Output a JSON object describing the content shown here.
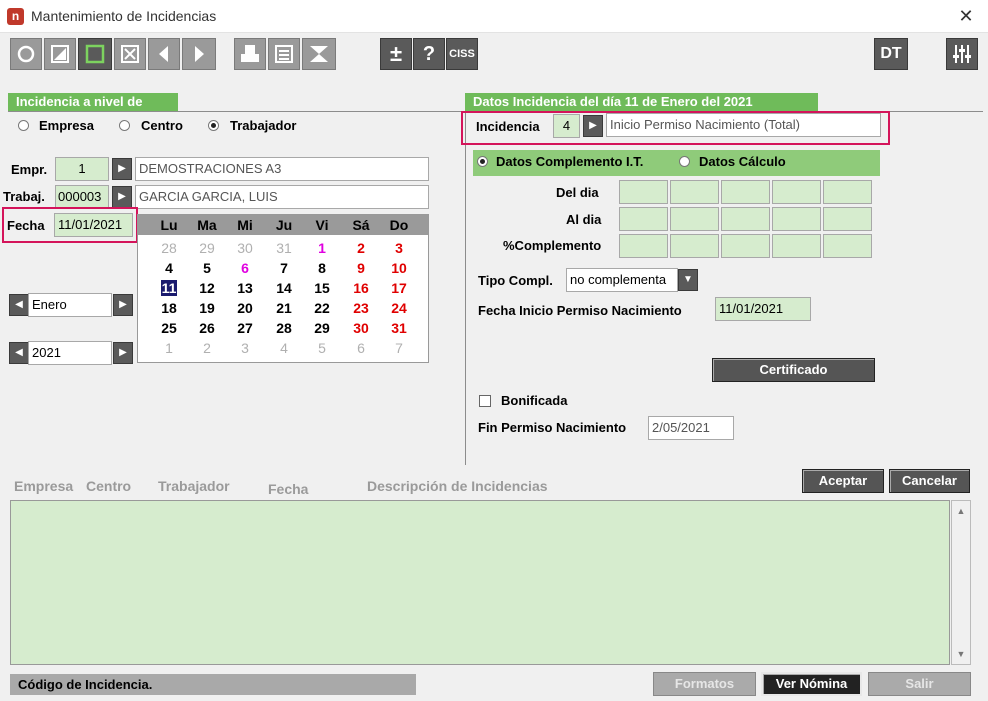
{
  "window": {
    "title": "Mantenimiento de Incidencias",
    "close_glyph": "✕",
    "app_icon_letter": "n"
  },
  "toolbar": {
    "plus_minus": "±",
    "help": "?",
    "ciss": "CISS",
    "dt": "DT"
  },
  "left": {
    "section_title": "Incidencia a nivel de",
    "radios": [
      {
        "label": "Empresa",
        "selected": false
      },
      {
        "label": "Centro",
        "selected": false
      },
      {
        "label": "Trabajador",
        "selected": true
      }
    ],
    "empr_label": "Empr.",
    "empr_code": "1",
    "empr_name": "DEMOSTRACIONES A3",
    "trabaj_label": "Trabaj.",
    "trabaj_code": "000003",
    "trabaj_name": "GARCIA GARCIA, LUIS",
    "fecha_label": "Fecha",
    "fecha_value": "11/01/2021",
    "month_value": "Enero",
    "year_value": "2021"
  },
  "calendar": {
    "headers": [
      "Lu",
      "Ma",
      "Mi",
      "Ju",
      "Vi",
      "Sá",
      "Do"
    ],
    "weeks": [
      [
        "28",
        "29",
        "30",
        "31",
        "1",
        "2",
        "3"
      ],
      [
        "4",
        "5",
        "6",
        "7",
        "8",
        "9",
        "10"
      ],
      [
        "11",
        "12",
        "13",
        "14",
        "15",
        "16",
        "17"
      ],
      [
        "18",
        "19",
        "20",
        "21",
        "22",
        "23",
        "24"
      ],
      [
        "25",
        "26",
        "27",
        "28",
        "29",
        "30",
        "31"
      ],
      [
        "1",
        "2",
        "3",
        "4",
        "5",
        "6",
        "7"
      ]
    ],
    "selected_day": "11"
  },
  "right": {
    "section_title": "Datos Incidencia del día 11 de Enero del 2021",
    "incidencia_label": "Incidencia",
    "incidencia_code": "4",
    "incidencia_desc": "Inicio Permiso Nacimiento (Total)",
    "tabs": [
      {
        "label": "Datos Complemento I.T.",
        "selected": true
      },
      {
        "label": "Datos Cálculo",
        "selected": false
      }
    ],
    "del_dia_label": "Del dia",
    "al_dia_label": "Al dia",
    "complemento_label": "%Complemento",
    "tipo_compl_label": "Tipo Compl.",
    "tipo_compl_value": "no complementa",
    "fecha_inicio_label": "Fecha Inicio Permiso Nacimiento",
    "fecha_inicio_value": "11/01/2021",
    "certificado_label": "Certificado",
    "bonificada_label": "Bonificada",
    "fin_permiso_label": "Fin Permiso Nacimiento",
    "fin_permiso_value": "2/05/2021"
  },
  "list": {
    "columns": [
      "Empresa",
      "Centro",
      "Trabajador",
      "Fecha",
      "Descripción de Incidencias"
    ],
    "aceptar_label": "Aceptar",
    "cancelar_label": "Cancelar"
  },
  "status": {
    "text": "Código de Incidencia.",
    "formatos_label": "Formatos",
    "ver_nomina_label": "Ver Nómina",
    "salir_label": "Salir"
  },
  "colors": {
    "accent_green": "#6fbb5a",
    "field_green": "#d6ecce",
    "highlight": "#d4145a",
    "calendar_red": "#e00000",
    "calendar_magenta": "#e000e0",
    "calendar_selected": "#1a1a6e"
  }
}
